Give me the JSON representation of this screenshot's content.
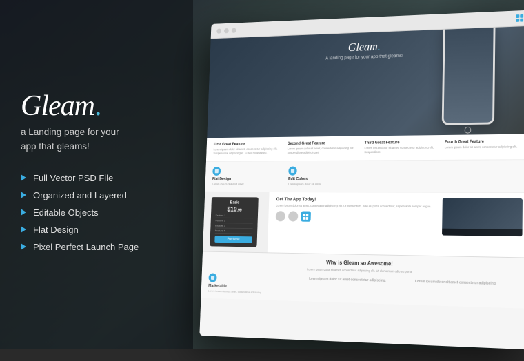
{
  "background": {
    "description": "Dark blurred mountain/landscape background"
  },
  "left_panel": {
    "logo": "Gleam",
    "logo_dot": ".",
    "tagline": "a Landing page for your\napp that gleams!",
    "features": [
      {
        "id": "feat1",
        "label": "Full Vector PSD File"
      },
      {
        "id": "feat2",
        "label": "Organized and Layered"
      },
      {
        "id": "feat3",
        "label": "Editable Objects"
      },
      {
        "id": "feat4",
        "label": "Flat Design"
      },
      {
        "id": "feat5",
        "label": "Pixel Perfect Launch Page"
      }
    ]
  },
  "browser_mockup": {
    "site": {
      "logo": "Gleam",
      "logo_dot": ".",
      "hero_tagline": "A landing page for your app that gleams!",
      "features_section": {
        "col1_title": "First Great Feature",
        "col1_text": "Lorem ipsum dolor sit amet, consectetur adipiscing elit. Suspendisse adipiscing et. Fusce molestie eu.",
        "col2_title": "Second Great Feature",
        "col2_text": "Lorem ipsum dolor sit amet, consectetur adipiscing elit. Suspendisse adipiscing et.",
        "col3_title": "Third Great Feature",
        "col3_text": "Lorem ipsum dolor sit amet, consectetur adipiscing elit. Suspendisse.",
        "col4_title": "Fourth Great Feature",
        "col4_text": "Lorem ipsum dolor sit amet, consectetur adipiscing elit."
      },
      "flat_section_title": "Flat Design",
      "flat_section_text": "Lorem ipsum dolor sit amet.",
      "edit_section_title": "Edit Colors",
      "pricing": {
        "plan": "Basic",
        "price": "$19",
        "cents": "99",
        "features": [
          "Feature 1",
          "Feature 2",
          "Feature 3",
          "Feature 4"
        ],
        "button": "Purchase"
      },
      "cta_title": "Get The App Today!",
      "cta_text": "Lorem ipsum dolor sit amet, consectetur adipiscing elit. Ut elementum, odio eu porta consectetur, sapien ante semper augue.",
      "why_title": "Why is Gleam so Awesome!",
      "why_text": "Lorem ipsum dolor sit amet, consectetur adipiscing elit. Ut elementum odio eu porta.",
      "marketable_title": "Marketable",
      "marketable_text": "Lorem ipsum dolor sit amet, consectetur adipiscing."
    }
  },
  "colors": {
    "accent": "#3aace0",
    "dark_bg": "#2a2a2a",
    "panel_bg": "rgba(20,25,30,0.75)"
  }
}
